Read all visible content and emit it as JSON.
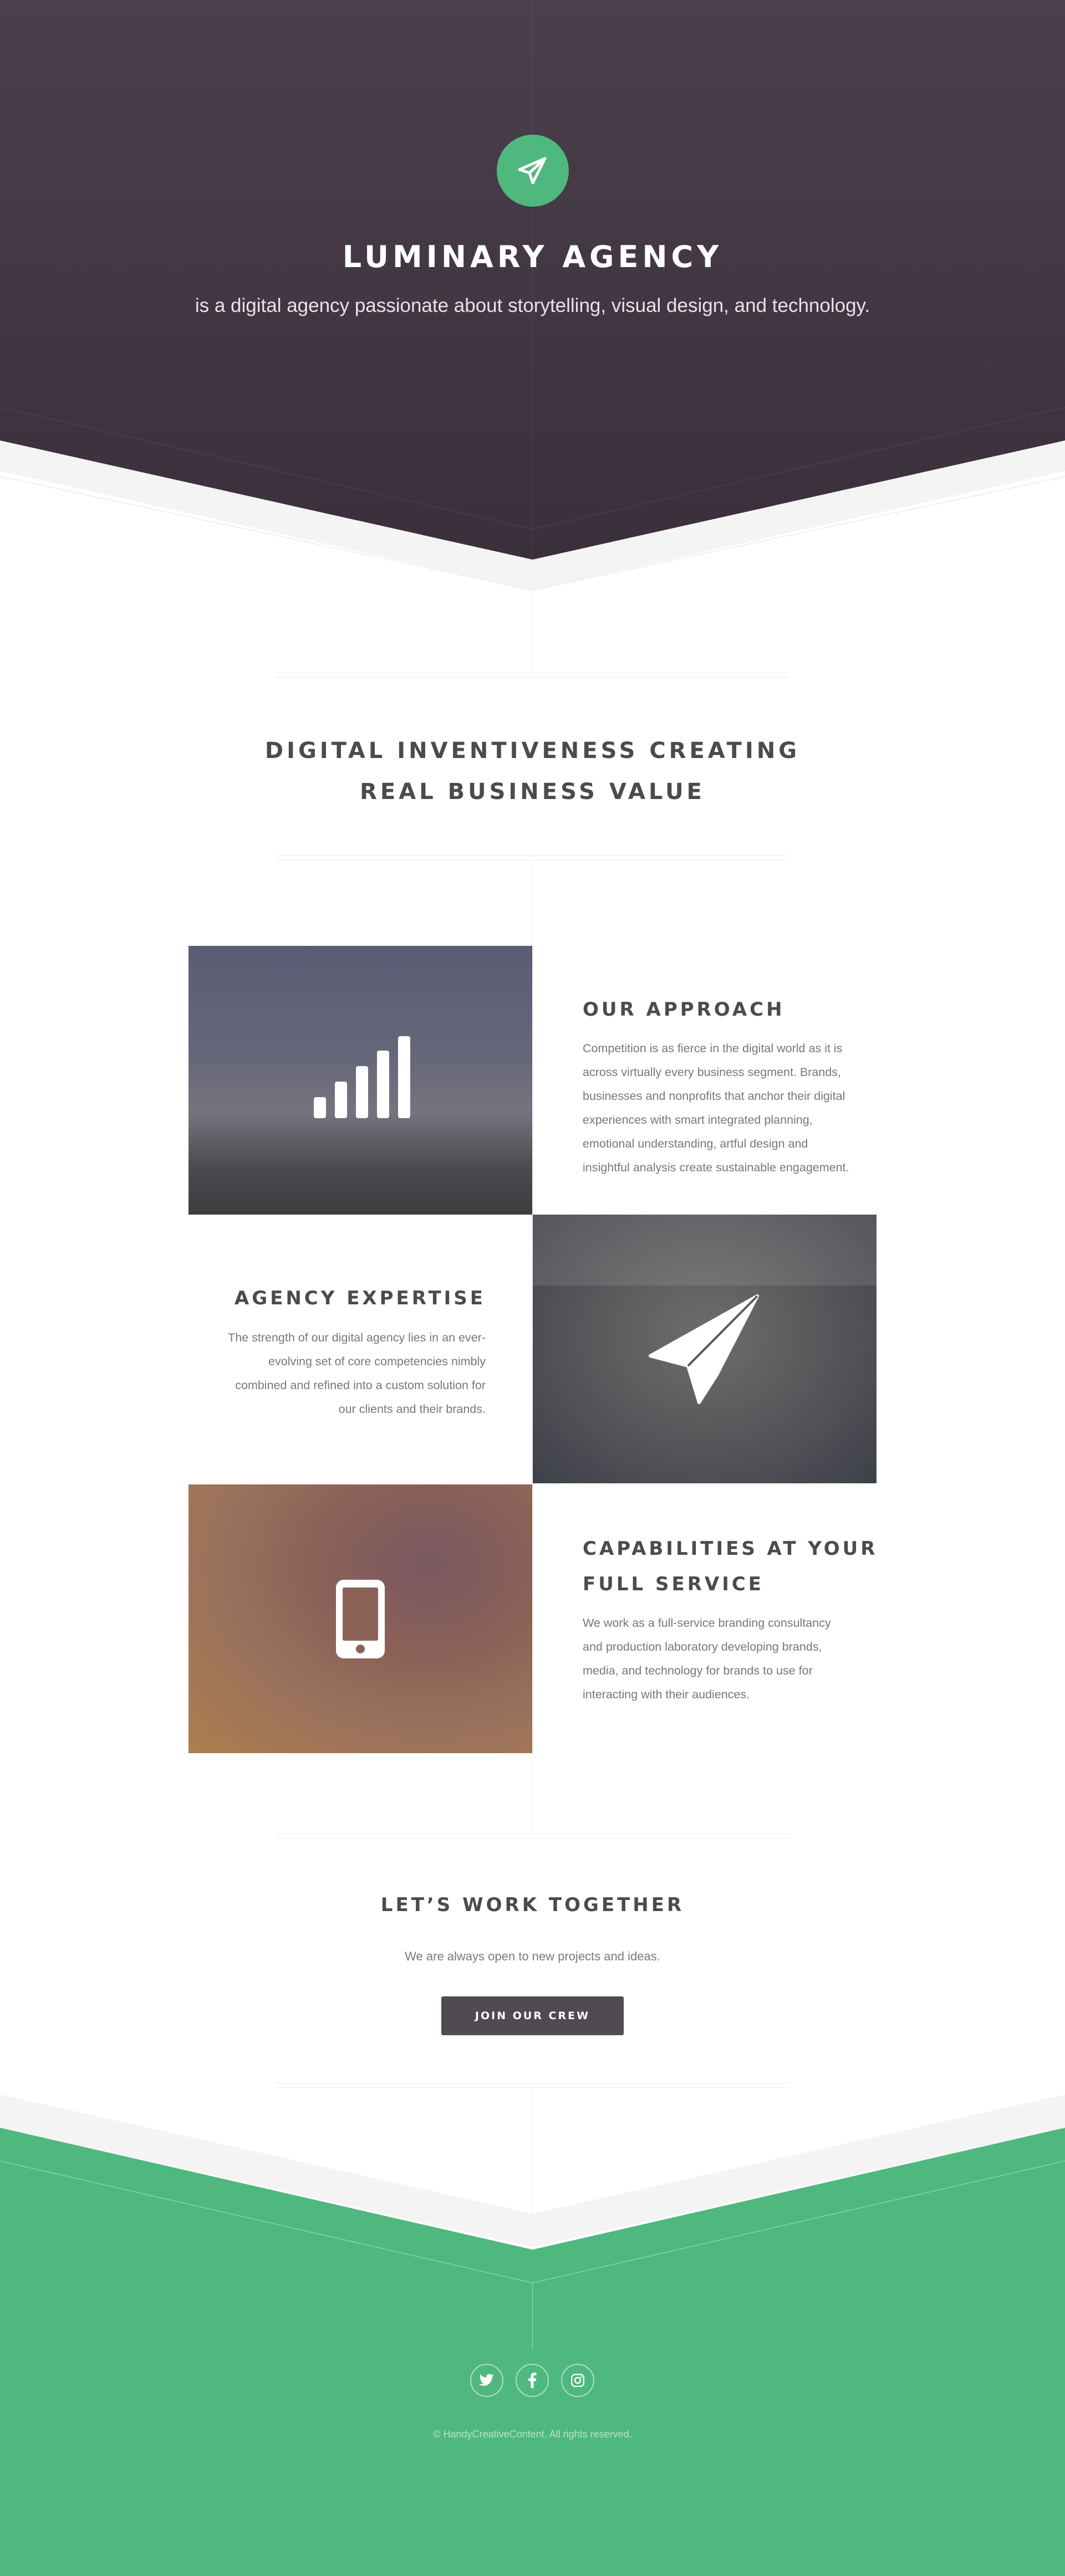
{
  "hero": {
    "icon": "paper-plane-icon",
    "title": "LUMINARY AGENCY",
    "subtitle": "is a digital agency passionate about storytelling, visual design, and technology."
  },
  "intro": {
    "title_line1": "DIGITAL INVENTIVENESS CREATING",
    "title_line2": "REAL BUSINESS VALUE"
  },
  "features": [
    {
      "icon": "signal-bars-icon",
      "title": "OUR APPROACH",
      "text_lines": [
        "Competition is as fierce in the digital world as it is",
        "across virtually every business segment. Brands,",
        "businesses and nonprofits that anchor their digital",
        "experiences with smart integrated planning,",
        "emotional understanding, artful design and",
        "insightful analysis create sustainable engagement."
      ]
    },
    {
      "icon": "paper-plane-icon",
      "title": "AGENCY EXPERTISE",
      "text_lines": [
        "The strength of our digital agency lies in an ever-",
        "evolving set of core competencies nimbly",
        "combined and refined into a custom solution for",
        "our clients and their brands."
      ]
    },
    {
      "icon": "mobile-phone-icon",
      "title_line1": "CAPABILITIES AT YOUR",
      "title_line2": "FULL SERVICE",
      "text_lines": [
        "We work as a full-service branding consultancy",
        "and production laboratory developing brands,",
        "media, and technology for brands to use for",
        "interacting with their audiences."
      ]
    }
  ],
  "cta": {
    "title": "LET’S WORK TOGETHER",
    "subtitle": "We are always open to new projects and ideas.",
    "button_label": "JOIN OUR CREW"
  },
  "footer": {
    "social": [
      "twitter-icon",
      "facebook-icon",
      "instagram-icon"
    ],
    "copyright": "© HandyCreativeContent. All rights reserved."
  },
  "colors": {
    "hero_dark": "#433843",
    "accent_green": "#4fb87f",
    "button_dark": "#514a51",
    "heading_text": "#4a4a4f"
  }
}
